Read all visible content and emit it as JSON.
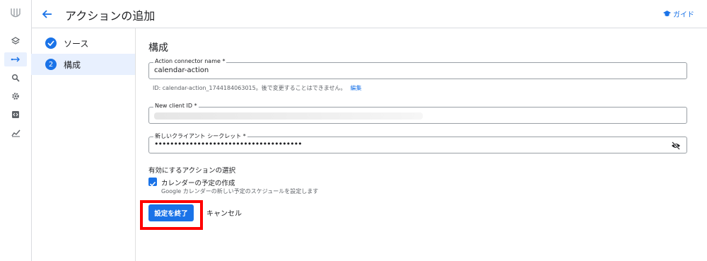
{
  "header": {
    "title": "アクションの追加",
    "guide_label": "ガイド"
  },
  "rail": {
    "icons": [
      "layers-icon",
      "arrows-icon",
      "search-icon",
      "gear-icon",
      "code-icon",
      "analytics-icon"
    ],
    "active_index": 1
  },
  "steps": [
    {
      "number": "",
      "label": "ソース",
      "state": "done"
    },
    {
      "number": "2",
      "label": "構成",
      "state": "active"
    }
  ],
  "main": {
    "heading": "構成",
    "connector_name": {
      "label": "Action connector name *",
      "value": "calendar-action",
      "helper": "ID: calendar-action_1744184063015。後で変更することはできません。",
      "edit_label": "編集"
    },
    "client_id": {
      "label": "New client ID *",
      "value": ""
    },
    "client_secret": {
      "label": "新しいクライアント シークレット *",
      "value": "••••••••••••••••••••••••••••••••••••••"
    },
    "actions_section_label": "有効にするアクションの選択",
    "action_option": {
      "label": "カレンダーの予定の作成",
      "description": "Google カレンダーの新しい予定のスケジュールを設定します",
      "checked": true
    },
    "finish_label": "設定を終了",
    "cancel_label": "キャンセル"
  },
  "colors": {
    "accent": "#1a73e8",
    "highlight": "#ff0000"
  }
}
